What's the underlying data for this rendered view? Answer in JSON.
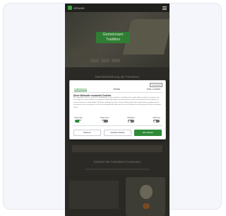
{
  "header": {
    "logo_text": "GRAND"
  },
  "hero": {
    "title": "Gemeinsam Tradition"
  },
  "section1": {
    "title": "Machtserfahrung als Pionieren"
  },
  "cookie_modal": {
    "tabs": [
      "Zustimmung",
      "Details",
      "Über Cookies"
    ],
    "active_tab_index": 0,
    "heading": "Diese Webseite verwendet Cookies",
    "body": "Wir verwenden Cookies, um Inhalte und Anzeigen zu personalisieren, Funktionen für soziale Medien anbieten zu können und die Zugriffe auf unsere Website zu analysieren. Außerdem geben wir Informationen zu Ihrer Verwendung unserer Website an unsere Partner für soziale Medien, Werbung und Analysen weiter. Unsere Partner führen diese Informationen möglicherweise mit weiteren Daten zusammen, die Sie ihnen bereitgestellt haben oder die sie im Rahmen Ihrer Nutzung der Dienste gesammelt haben.",
    "toggles": [
      {
        "label": "Notwendig",
        "on": true
      },
      {
        "label": "Präferenzen",
        "on": false
      },
      {
        "label": "Statistiken",
        "on": false
      },
      {
        "label": "Marketing",
        "on": false
      }
    ],
    "buttons": {
      "deny": "Ablehnen",
      "allow_selection": "Auswahl erlauben",
      "allow_all": "Alle zulassen"
    },
    "brand_logo": "Cookiebot"
  },
  "section2": {
    "title": "Karriere bei Transitions Consumer"
  },
  "colors": {
    "accent": "#2e8a39",
    "overlay": "#2b2a26"
  }
}
